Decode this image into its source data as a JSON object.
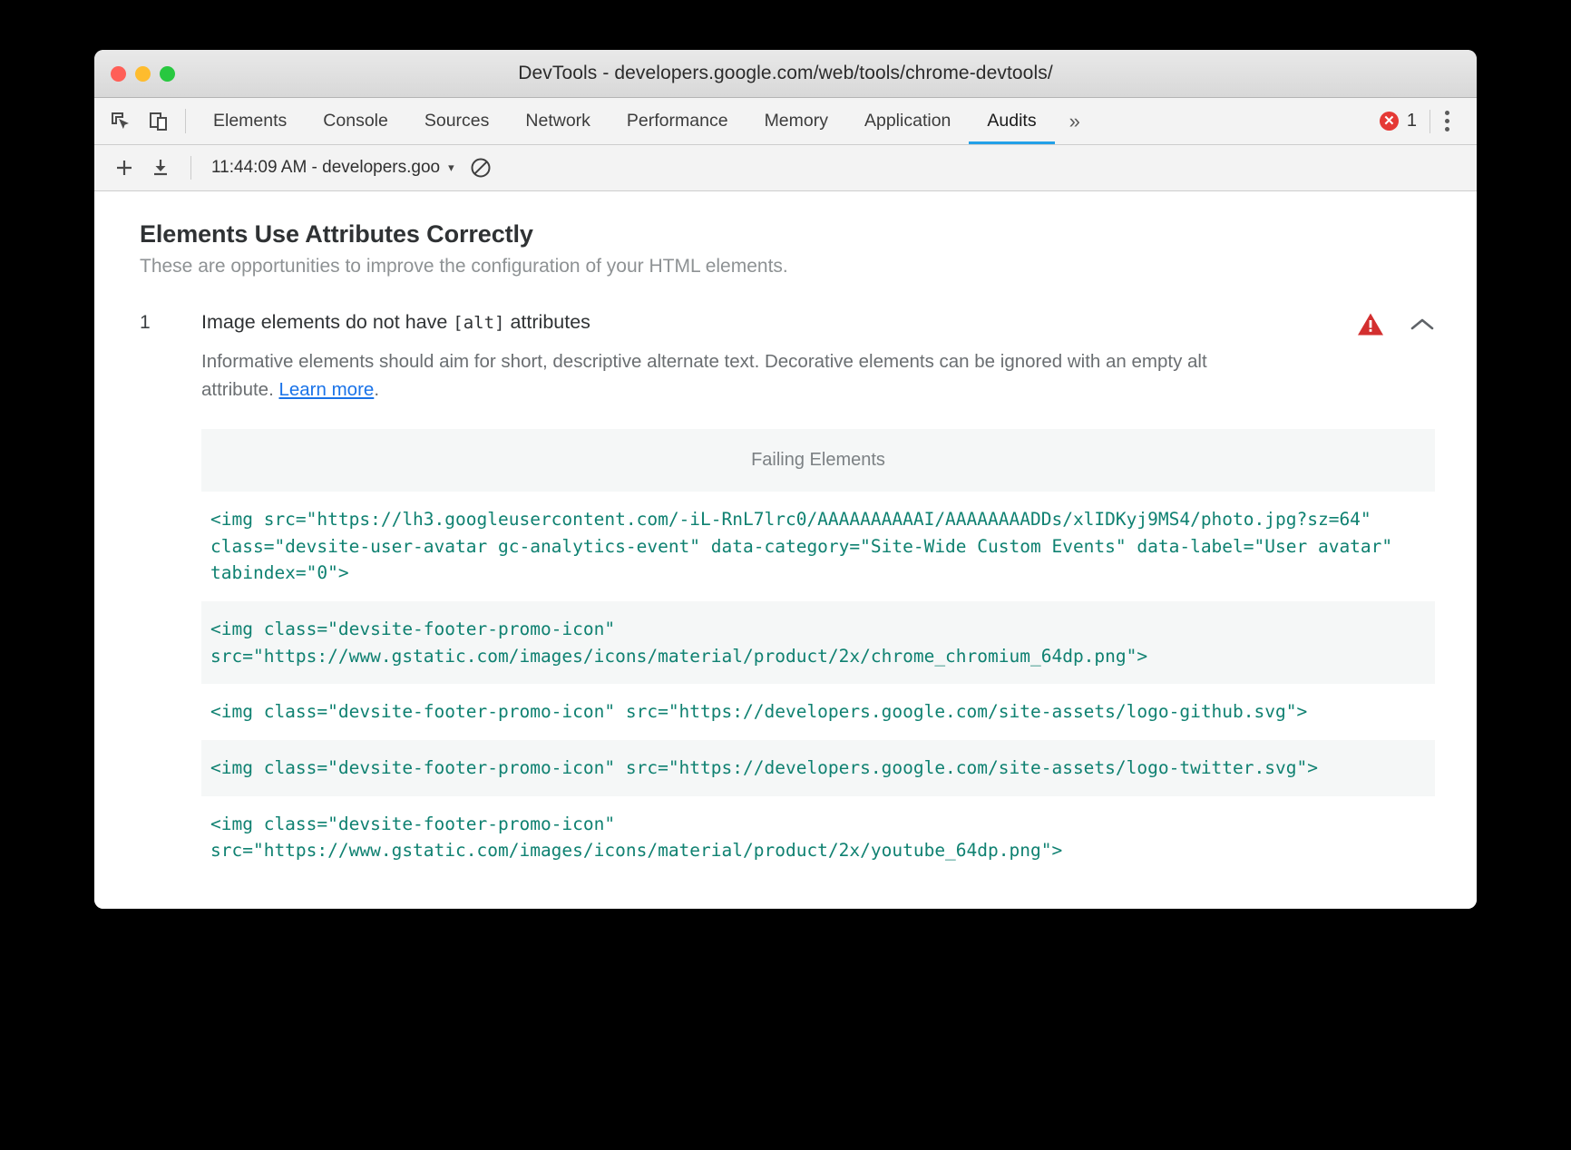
{
  "window": {
    "title": "DevTools - developers.google.com/web/tools/chrome-devtools/",
    "traffic_lights": [
      "close",
      "minimize",
      "zoom"
    ]
  },
  "toolbar": {
    "inspect_icon": "inspect-element-icon",
    "device_icon": "device-toolbar-icon",
    "tabs": [
      {
        "label": "Elements",
        "active": false
      },
      {
        "label": "Console",
        "active": false
      },
      {
        "label": "Sources",
        "active": false
      },
      {
        "label": "Network",
        "active": false
      },
      {
        "label": "Performance",
        "active": false
      },
      {
        "label": "Memory",
        "active": false
      },
      {
        "label": "Application",
        "active": false
      },
      {
        "label": "Audits",
        "active": true
      }
    ],
    "more_tabs_label": "»",
    "error_count": "1",
    "error_glyph": "✕",
    "menu_icon": "kebab-menu-icon",
    "accent_color": "#22a0e8",
    "error_color": "#e53935"
  },
  "subbar": {
    "add_label": "+",
    "download_label": "⬇",
    "run_selection": "11:44:09 AM - developers.goo",
    "caret": "▾",
    "clear_icon": "no-entry-icon"
  },
  "report": {
    "title": "Elements Use Attributes Correctly",
    "subtitle": "These are opportunities to improve the configuration of your HTML elements.",
    "audit": {
      "index": "1",
      "title_before": "Image elements do not have ",
      "title_code": "[alt]",
      "title_after": " attributes",
      "description_before": "Informative elements should aim for short, descriptive alternate text. Decorative elements can be ignored with an empty alt attribute. ",
      "learn_more_label": "Learn more",
      "description_after": ".",
      "warning_icon": "warning-triangle-icon",
      "collapse_icon": "chevron-up-icon",
      "failing_header": "Failing Elements",
      "failing_elements": [
        "<img src=\"https://lh3.googleusercontent.com/-iL-RnL7lrc0/AAAAAAAAAAI/AAAAAAAADDs/xlIDKyj9MS4/photo.jpg?sz=64\" class=\"devsite-user-avatar gc-analytics-event\" data-category=\"Site-Wide Custom Events\" data-label=\"User avatar\" tabindex=\"0\">",
        "<img class=\"devsite-footer-promo-icon\" src=\"https://www.gstatic.com/images/icons/material/product/2x/chrome_chromium_64dp.png\">",
        "<img class=\"devsite-footer-promo-icon\" src=\"https://developers.google.com/site-assets/logo-github.svg\">",
        "<img class=\"devsite-footer-promo-icon\" src=\"https://developers.google.com/site-assets/logo-twitter.svg\">",
        "<img class=\"devsite-footer-promo-icon\" src=\"https://www.gstatic.com/images/icons/material/product/2x/youtube_64dp.png\">"
      ]
    }
  }
}
